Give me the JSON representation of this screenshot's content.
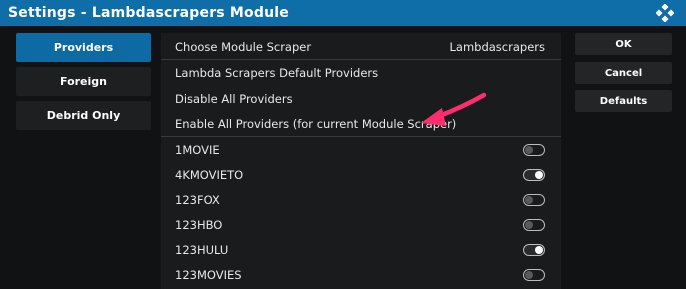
{
  "window": {
    "title": "Settings - Lambdascrapers Module"
  },
  "categories": [
    {
      "label": "Providers",
      "active": true
    },
    {
      "label": "Foreign",
      "active": false
    },
    {
      "label": "Debrid Only",
      "active": false
    }
  ],
  "settings": {
    "module_scraper": {
      "label": "Choose Module Scraper",
      "value": "Lambdascrapers"
    },
    "actions": [
      "Lambda Scrapers Default Providers",
      "Disable All Providers",
      "Enable All Providers (for current Module Scraper)"
    ],
    "providers": [
      {
        "name": "1MOVIE",
        "enabled": false
      },
      {
        "name": "4KMOVIETO",
        "enabled": true
      },
      {
        "name": "123FOX",
        "enabled": false
      },
      {
        "name": "123HBO",
        "enabled": false
      },
      {
        "name": "123HULU",
        "enabled": true
      },
      {
        "name": "123MOVIES",
        "enabled": false
      }
    ]
  },
  "buttons": {
    "ok": "OK",
    "cancel": "Cancel",
    "defaults": "Defaults"
  },
  "colors": {
    "titlebar": "#0f6ea8",
    "active_category": "#0e6aa3",
    "annotation_arrow": "#ff2d6f"
  },
  "icons": {
    "logo": "kodi-logo-icon",
    "annotation": "pink-arrow-annotation"
  }
}
